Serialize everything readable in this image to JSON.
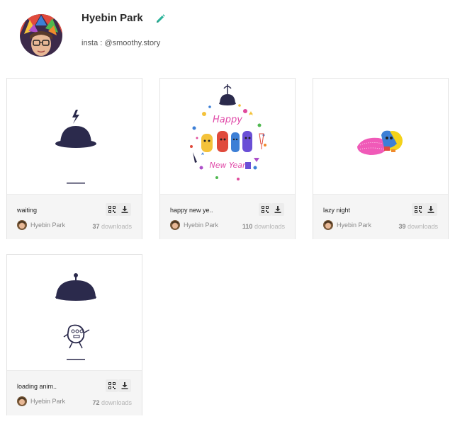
{
  "profile": {
    "name": "Hyebin Park",
    "bio": "insta : @smoothy.story"
  },
  "cards": [
    {
      "title": "waiting",
      "author": "Hyebin Park",
      "downloads_count": "37",
      "downloads_label": "downloads"
    },
    {
      "title": "happy new ye..",
      "author": "Hyebin Park",
      "downloads_count": "110",
      "downloads_label": "downloads"
    },
    {
      "title": "lazy night",
      "author": "Hyebin Park",
      "downloads_count": "39",
      "downloads_label": "downloads"
    },
    {
      "title": "loading anim..",
      "author": "Hyebin Park",
      "downloads_count": "72",
      "downloads_label": "downloads"
    }
  ],
  "colors": {
    "edit_icon": "#2bb39a",
    "icon_navy": "#2b2a4c",
    "card_info_bg": "#f5f5f5"
  },
  "icons": {
    "edit": "pencil-icon",
    "qr": "qr-code-icon",
    "download": "download-icon"
  }
}
